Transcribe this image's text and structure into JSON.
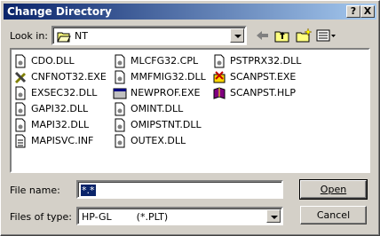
{
  "title": "Change Directory",
  "title_buttons": {
    "help": "?",
    "close": "X"
  },
  "look_in": {
    "label": "Look in:",
    "value": "NT"
  },
  "files": {
    "col1": [
      "CDO.DLL",
      "CNFNOT32.EXE",
      "EXSEC32.DLL",
      "GAPI32.DLL",
      "MAPI32.DLL",
      "MAPISVC.INF"
    ],
    "col2": [
      "MLCFG32.CPL",
      "MMFMIG32.DLL",
      "NEWPROF.EXE",
      "OMINT.DLL",
      "OMIPSTNT.DLL",
      "OUTEX.DLL"
    ],
    "col3": [
      "PSTPRX32.DLL",
      "SCANPST.EXE",
      "SCANPST.HLP"
    ]
  },
  "file_name": {
    "label": "File name:",
    "value": "*.*"
  },
  "file_type": {
    "label": "Files of type:",
    "value": "HP-GL        (*.PLT)"
  },
  "buttons": {
    "open": "Open",
    "cancel": "Cancel"
  }
}
